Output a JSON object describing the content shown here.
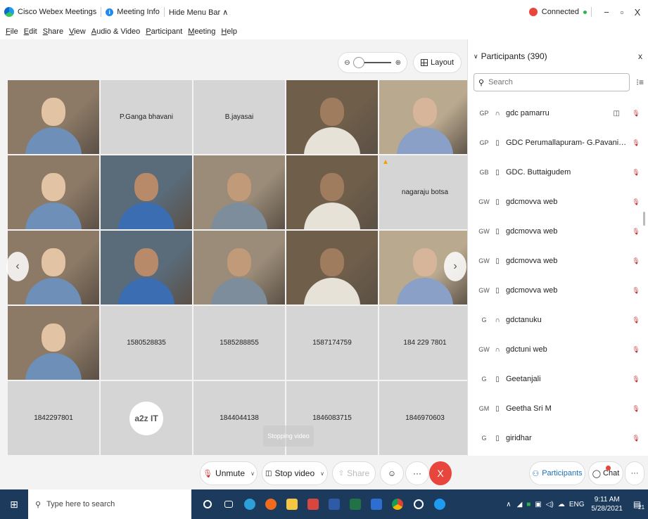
{
  "titlebar": {
    "app_name": "Cisco Webex Meetings",
    "meeting_info": "Meeting Info",
    "hide_menu": "Hide Menu Bar ∧",
    "status": "Connected",
    "minimize": "−",
    "restore": "▫",
    "close": "X"
  },
  "menu": [
    "File",
    "Edit",
    "Share",
    "View",
    "Audio & Video",
    "Participant",
    "Meeting",
    "Help"
  ],
  "stage": {
    "layout_label": "Layout",
    "zoom_out_icon": "zoom-out-icon",
    "zoom_in_icon": "zoom-in-icon",
    "stopping_video": "Stopping video"
  },
  "tiles": [
    {
      "type": "video",
      "label": ""
    },
    {
      "type": "name",
      "label": "P.Ganga bhavani"
    },
    {
      "type": "name",
      "label": "B.jayasai"
    },
    {
      "type": "video",
      "label": ""
    },
    {
      "type": "video",
      "label": ""
    },
    {
      "type": "video",
      "label": ""
    },
    {
      "type": "video",
      "label": ""
    },
    {
      "type": "video",
      "label": ""
    },
    {
      "type": "video",
      "label": ""
    },
    {
      "type": "name",
      "label": "nagaraju botsa"
    },
    {
      "type": "video",
      "label": ""
    },
    {
      "type": "video",
      "label": ""
    },
    {
      "type": "video",
      "label": ""
    },
    {
      "type": "video",
      "label": ""
    },
    {
      "type": "video",
      "label": ""
    },
    {
      "type": "video",
      "label": ""
    },
    {
      "type": "name",
      "label": "1580528835"
    },
    {
      "type": "name",
      "label": "1585288855"
    },
    {
      "type": "name",
      "label": "1587174759"
    },
    {
      "type": "name",
      "label": "184 229 7801"
    },
    {
      "type": "name",
      "label": "1842297801"
    },
    {
      "type": "logo",
      "label": "a2z IT"
    },
    {
      "type": "name",
      "label": "1844044138"
    },
    {
      "type": "name",
      "label": "1846083715"
    },
    {
      "type": "name",
      "label": "1846970603"
    }
  ],
  "controls": {
    "unmute": "Unmute",
    "stop_video": "Stop video",
    "share": "Share",
    "more": "···",
    "end": "X"
  },
  "panel": {
    "title": "Participants (390)",
    "close": "x",
    "search_placeholder": "Search",
    "participants": [
      {
        "initials": "GP",
        "device": "headset",
        "name": "gdc pamarru",
        "camera": true
      },
      {
        "initials": "GP",
        "device": "phone",
        "name": "GDC Perumallapuram- G.Pavani Dev...",
        "camera": false
      },
      {
        "initials": "GB",
        "device": "phone",
        "name": "GDC. Buttaigudem",
        "camera": false
      },
      {
        "initials": "GW",
        "device": "phone",
        "name": "gdcmovva web",
        "camera": false
      },
      {
        "initials": "GW",
        "device": "phone",
        "name": "gdcmovva web",
        "camera": false
      },
      {
        "initials": "GW",
        "device": "phone",
        "name": "gdcmovva web",
        "camera": false
      },
      {
        "initials": "GW",
        "device": "phone",
        "name": "gdcmovva web",
        "camera": false
      },
      {
        "initials": "G",
        "device": "headset",
        "name": "gdctanuku",
        "camera": false
      },
      {
        "initials": "GW",
        "device": "headset",
        "name": "gdctuni web",
        "camera": false
      },
      {
        "initials": "G",
        "device": "phone",
        "name": "Geetanjali",
        "camera": false
      },
      {
        "initials": "GM",
        "device": "phone",
        "name": "Geetha Sri M",
        "camera": false
      },
      {
        "initials": "G",
        "device": "phone",
        "name": "giridhar",
        "camera": false
      }
    ],
    "participants_btn": "Participants",
    "chat_btn": "Chat",
    "more_btn": "···"
  },
  "taskbar": {
    "search_placeholder": "Type here to search",
    "lang": "ENG",
    "time": "9:11 AM",
    "date": "5/28/2021",
    "notifications": "21"
  }
}
